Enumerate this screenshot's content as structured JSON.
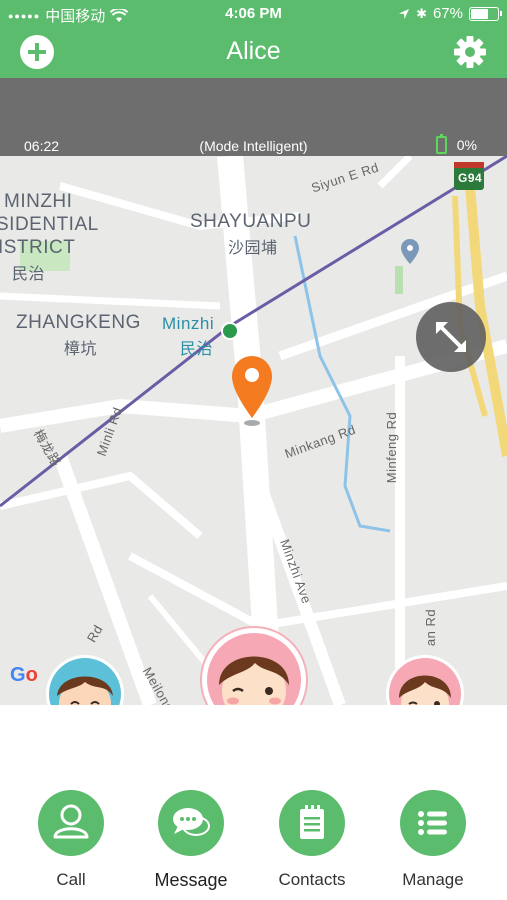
{
  "status_bar": {
    "carrier": "中国移动",
    "time": "4:06 PM",
    "battery_percent": "67%",
    "battery_level": 0.67
  },
  "header": {
    "title": "Alice",
    "add_icon": "plus-circle-icon",
    "settings_icon": "gear-icon"
  },
  "info_bar": {
    "time": "06:22",
    "mode": "(Mode Intelligent)",
    "battery": "0%"
  },
  "map": {
    "labels": {
      "minzhi_res_1": "MINZHI",
      "minzhi_res_2": "SIDENTIAL",
      "minzhi_res_3": "ISTRICT",
      "minzhi_res_cn": "民治",
      "shayuanpu": "SHAYUANPU",
      "shayuanpu_cn": "沙园埔",
      "zhangkeng": "ZHANGKENG",
      "zhangkeng_cn": "樟坑",
      "minzhi_station": "Minzhi",
      "minzhi_station_cn": "民治",
      "siyun_rd": "Siyun E Rd",
      "minkang_rd": "Minkang Rd",
      "minfeng_rd": "Minfeng Rd",
      "minli_rd": "Minli Rd",
      "minzhi_ave": "Minzhi Ave",
      "meilong": "Meilong",
      "meilong_cn": "梅龙路",
      "rd_left": "Rd",
      "an_rd": "an Rd",
      "highway": "G94"
    },
    "google_logo": "Go"
  },
  "colors": {
    "brand_green": "#5cbc6e",
    "pin_orange": "#f47b20",
    "metro_purple": "#6b5ca5"
  },
  "actions": [
    {
      "label": "Call",
      "icon": "person-icon"
    },
    {
      "label": "Message",
      "icon": "chat-bubbles-icon"
    },
    {
      "label": "Contacts",
      "icon": "clipboard-icon"
    },
    {
      "label": "Manage",
      "icon": "list-icon"
    }
  ]
}
